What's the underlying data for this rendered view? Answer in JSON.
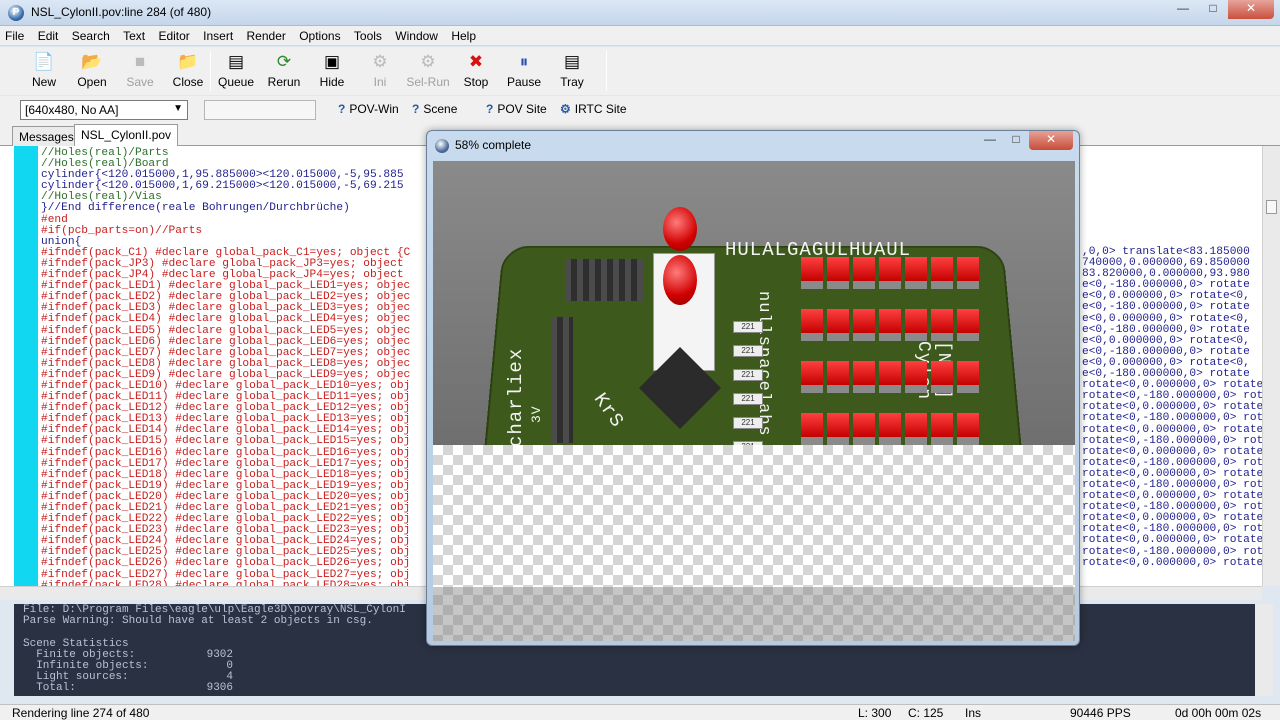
{
  "window": {
    "title": "NSL_CylonII.pov:line 284 (of 480)",
    "app_icon": "povray-icon"
  },
  "menu": [
    "File",
    "Edit",
    "Search",
    "Text",
    "Editor",
    "Insert",
    "Render",
    "Options",
    "Tools",
    "Window",
    "Help"
  ],
  "toolbar": [
    {
      "label": "New",
      "icon": "new-file-icon",
      "enabled": true
    },
    {
      "label": "Open",
      "icon": "open-folder-icon",
      "enabled": true
    },
    {
      "label": "Save",
      "icon": "save-icon",
      "enabled": false
    },
    {
      "label": "Close",
      "icon": "close-file-icon",
      "enabled": true
    },
    {
      "label": "Queue",
      "icon": "queue-icon",
      "enabled": true
    },
    {
      "label": "Rerun",
      "icon": "rerun-icon",
      "enabled": true
    },
    {
      "label": "Hide",
      "icon": "hide-icon",
      "enabled": true
    },
    {
      "label": "Ini",
      "icon": "ini-icon",
      "enabled": false
    },
    {
      "label": "Sel-Run",
      "icon": "sel-run-icon",
      "enabled": false
    },
    {
      "label": "Stop",
      "icon": "stop-icon",
      "enabled": true
    },
    {
      "label": "Pause",
      "icon": "pause-icon",
      "enabled": true
    },
    {
      "label": "Tray",
      "icon": "tray-icon",
      "enabled": true
    }
  ],
  "toolbar2": {
    "resolution": "[640x480, No AA]",
    "links": [
      "POV-Win",
      "Scene",
      "POV Site",
      "IRTC Site"
    ]
  },
  "tabs": [
    "Messages",
    "NSL_CylonII.pov"
  ],
  "code_lines": [
    "//Holes(real)/Parts",
    "//Holes(real)/Board",
    "cylinder{<120.015000,1,95.885000><120.015000,-5,95.885",
    "cylinder{<120.015000,1,69.215000><120.015000,-5,69.215",
    "//Holes(real)/Vias",
    "}//End difference(reale Bohrungen/Durchbrüche)",
    "#end",
    "#if(pcb_parts=on)//Parts",
    "union{",
    "#ifndef(pack_C1) #declare global_pack_C1=yes; object {C",
    "#ifndef(pack_JP3) #declare global_pack_JP3=yes; object",
    "#ifndef(pack_JP4) #declare global_pack_JP4=yes; object",
    "#ifndef(pack_LED1) #declare global_pack_LED1=yes; objec",
    "#ifndef(pack_LED2) #declare global_pack_LED2=yes; objec",
    "#ifndef(pack_LED3) #declare global_pack_LED3=yes; objec",
    "#ifndef(pack_LED4) #declare global_pack_LED4=yes; objec",
    "#ifndef(pack_LED5) #declare global_pack_LED5=yes; objec",
    "#ifndef(pack_LED6) #declare global_pack_LED6=yes; objec",
    "#ifndef(pack_LED7) #declare global_pack_LED7=yes; objec",
    "#ifndef(pack_LED8) #declare global_pack_LED8=yes; objec",
    "#ifndef(pack_LED9) #declare global_pack_LED9=yes; objec",
    "#ifndef(pack_LED10) #declare global_pack_LED10=yes; obj",
    "#ifndef(pack_LED11) #declare global_pack_LED11=yes; obj",
    "#ifndef(pack_LED12) #declare global_pack_LED12=yes; obj",
    "#ifndef(pack_LED13) #declare global_pack_LED13=yes; obj",
    "#ifndef(pack_LED14) #declare global_pack_LED14=yes; obj",
    "#ifndef(pack_LED15) #declare global_pack_LED15=yes; obj",
    "#ifndef(pack_LED16) #declare global_pack_LED16=yes; obj",
    "#ifndef(pack_LED17) #declare global_pack_LED17=yes; obj",
    "#ifndef(pack_LED18) #declare global_pack_LED18=yes; obj",
    "#ifndef(pack_LED19) #declare global_pack_LED19=yes; obj",
    "#ifndef(pack_LED20) #declare global_pack_LED20=yes; obj",
    "#ifndef(pack_LED21) #declare global_pack_LED21=yes; obj",
    "#ifndef(pack_LED22) #declare global_pack_LED22=yes; obj",
    "#ifndef(pack_LED23) #declare global_pack_LED23=yes; obj",
    "#ifndef(pack_LED24) #declare global_pack_LED24=yes; obj",
    "#ifndef(pack_LED25) #declare global_pack_LED25=yes; obj",
    "#ifndef(pack_LED26) #declare global_pack_LED26=yes; obj",
    "#ifndef(pack_LED27) #declare global_pack_LED27=yes; obj",
    "#ifndef(pack_LED28) #declare global_pack_LED28=yes; obj"
  ],
  "code_right": [
    ",0,0> translate<83.185000",
    "740000,0.000000,69.850000",
    "83.820000,0.000000,93.980",
    "e<0,-180.000000,0> rotate",
    "e<0,0.000000,0> rotate<0,",
    "e<0,-180.000000,0> rotate",
    "e<0,0.000000,0> rotate<0,",
    "e<0,-180.000000,0> rotate",
    "e<0,0.000000,0> rotate<0,",
    "e<0,-180.000000,0> rotate",
    "e<0,0.000000,0> rotate<0,",
    "e<0,-180.000000,0> rotate",
    "rotate<0,0.000000,0> rotate",
    "rotate<0,-180.000000,0> rota",
    "rotate<0,0.000000,0> rotate",
    "rotate<0,-180.000000,0> rota",
    "rotate<0,0.000000,0> rotate",
    "rotate<0,-180.000000,0> rota",
    "rotate<0,0.000000,0> rotate",
    "rotate<0,-180.000000,0> rota",
    "rotate<0,0.000000,0> rotate",
    "rotate<0,-180.000000,0> rota",
    "rotate<0,0.000000,0> rotate",
    "rotate<0,-180.000000,0> rota",
    "rotate<0,0.000000,0> rotate",
    "rotate<0,-180.000000,0> rota",
    "rotate<0,0.000000,0> rotate",
    "rotate<0,-180.000000,0> rota",
    "rotate<0,0.000000,0> rotate"
  ],
  "messages": {
    "file_line": "File: D:\\Program Files\\eagle\\ulp\\Eagle3D\\povray\\NSL_CylonI",
    "warning": "Parse Warning: Should have at least 2 objects in csg.",
    "stats_title": "Scene Statistics",
    "stats": [
      {
        "label": "Finite objects:",
        "value": "9302"
      },
      {
        "label": "Infinite objects:",
        "value": "0"
      },
      {
        "label": "Light sources:",
        "value": "4"
      },
      {
        "label": "Total:",
        "value": "9306"
      }
    ]
  },
  "status": {
    "left": "Rendering line 274 of 480",
    "line": "L: 300",
    "col": "C: 125",
    "mode": "Ins",
    "pps": "90446 PPS",
    "time": "0d 00h 00m 02s"
  },
  "render_window": {
    "title": "58% complete",
    "progress": 0.58,
    "pcb_labels": {
      "top": "HULALGAGULHUAUL",
      "right": "[NSL] Cylon",
      "middle": "nullspacelabs",
      "left": "charliex",
      "left2": "3V",
      "angled": "KrS",
      "small": "3V"
    },
    "resistor_label": "221"
  }
}
